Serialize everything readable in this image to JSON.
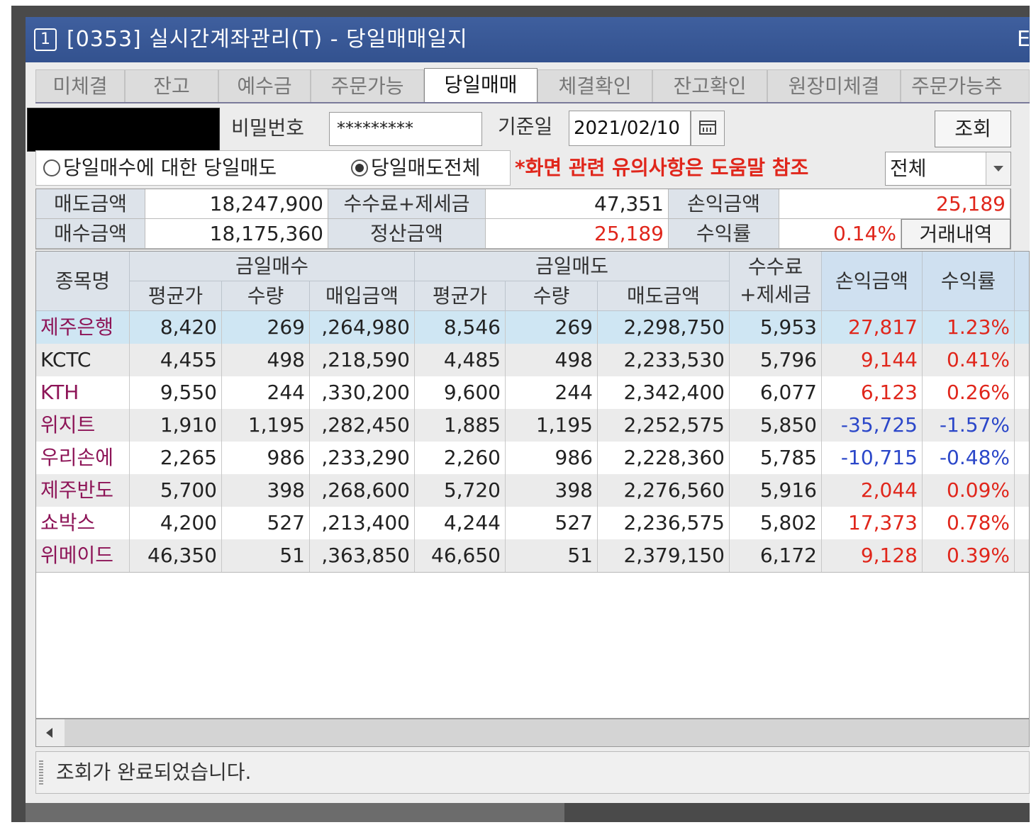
{
  "window": {
    "number": "1",
    "title": "[0353] 실시간계좌관리(T) - 당일매매일지",
    "title_right_glyph": "E"
  },
  "tabs": [
    {
      "label": "미체결",
      "active": false
    },
    {
      "label": "잔고",
      "active": false
    },
    {
      "label": "예수금",
      "active": false
    },
    {
      "label": "주문가능",
      "active": false
    },
    {
      "label": "당일매매",
      "active": true
    },
    {
      "label": "체결확인",
      "active": false
    },
    {
      "label": "잔고확인",
      "active": false
    },
    {
      "label": "원장미체결",
      "active": false
    },
    {
      "label": "주문가능추",
      "active": false
    }
  ],
  "query": {
    "password_label": "비밀번호",
    "password_value": "*********",
    "date_label": "기준일",
    "date_value": "2021/02/10",
    "search_button": "조회"
  },
  "options": {
    "radio1": "당일매수에 대한 당일매도",
    "radio2": "당일매도전체",
    "selected": "radio2",
    "notice": "*화면 관련 유의사항은 도움말 참조",
    "filter_value": "전체"
  },
  "summary": {
    "sell_amount_label": "매도금액",
    "sell_amount": "18,247,900",
    "fee_tax_label": "수수료+제세금",
    "fee_tax": "47,351",
    "pnl_label": "손익금액",
    "pnl": "25,189",
    "buy_amount_label": "매수금액",
    "buy_amount": "18,175,360",
    "settle_label": "정산금액",
    "settle": "25,189",
    "return_label": "수익률",
    "return_rate": "0.14%",
    "history_button": "거래내역"
  },
  "table": {
    "headers": {
      "name": "종목명",
      "buy_group": "금일매수",
      "sell_group": "금일매도",
      "fee_line1": "수수료",
      "fee_line2": "+제세금",
      "pnl": "손익금액",
      "rate": "수익률",
      "buy_avg": "평균가",
      "buy_qty": "수량",
      "buy_amount": "매입금액",
      "sell_avg": "평균가",
      "sell_qty": "수량",
      "sell_amount": "매도금액"
    },
    "rows": [
      {
        "name": "제주은행",
        "buy_avg": "8,420",
        "buy_qty": "269",
        "buy_amount": ",264,980",
        "sell_avg": "8,546",
        "sell_qty": "269",
        "sell_amount": "2,298,750",
        "fee": "5,953",
        "pnl": "27,817",
        "rate": "1.23%",
        "sign": "pos",
        "name_color": "#8d1457",
        "selected": true
      },
      {
        "name": "KCTC",
        "buy_avg": "4,455",
        "buy_qty": "498",
        "buy_amount": ",218,590",
        "sell_avg": "4,485",
        "sell_qty": "498",
        "sell_amount": "2,233,530",
        "fee": "5,796",
        "pnl": "9,144",
        "rate": "0.41%",
        "sign": "pos",
        "name_color": "#222222",
        "selected": false
      },
      {
        "name": "KTH",
        "buy_avg": "9,550",
        "buy_qty": "244",
        "buy_amount": ",330,200",
        "sell_avg": "9,600",
        "sell_qty": "244",
        "sell_amount": "2,342,400",
        "fee": "6,077",
        "pnl": "6,123",
        "rate": "0.26%",
        "sign": "pos",
        "name_color": "#8d1457",
        "selected": false
      },
      {
        "name": "위지트",
        "buy_avg": "1,910",
        "buy_qty": "1,195",
        "buy_amount": ",282,450",
        "sell_avg": "1,885",
        "sell_qty": "1,195",
        "sell_amount": "2,252,575",
        "fee": "5,850",
        "pnl": "-35,725",
        "rate": "-1.57%",
        "sign": "neg",
        "name_color": "#8d1457",
        "selected": false
      },
      {
        "name": "우리손에",
        "buy_avg": "2,265",
        "buy_qty": "986",
        "buy_amount": ",233,290",
        "sell_avg": "2,260",
        "sell_qty": "986",
        "sell_amount": "2,228,360",
        "fee": "5,785",
        "pnl": "-10,715",
        "rate": "-0.48%",
        "sign": "neg",
        "name_color": "#8d1457",
        "selected": false
      },
      {
        "name": "제주반도",
        "buy_avg": "5,700",
        "buy_qty": "398",
        "buy_amount": ",268,600",
        "sell_avg": "5,720",
        "sell_qty": "398",
        "sell_amount": "2,276,560",
        "fee": "5,916",
        "pnl": "2,044",
        "rate": "0.09%",
        "sign": "pos",
        "name_color": "#8d1457",
        "selected": false
      },
      {
        "name": "쇼박스",
        "buy_avg": "4,200",
        "buy_qty": "527",
        "buy_amount": ",213,400",
        "sell_avg": "4,244",
        "sell_qty": "527",
        "sell_amount": "2,236,575",
        "fee": "5,802",
        "pnl": "17,373",
        "rate": "0.78%",
        "sign": "pos",
        "name_color": "#8d1457",
        "selected": false
      },
      {
        "name": "위메이드",
        "buy_avg": "46,350",
        "buy_qty": "51",
        "buy_amount": ",363,850",
        "sell_avg": "46,650",
        "sell_qty": "51",
        "sell_amount": "2,379,150",
        "fee": "6,172",
        "pnl": "9,128",
        "rate": "0.39%",
        "sign": "pos",
        "name_color": "#8d1457",
        "selected": false
      }
    ]
  },
  "status": {
    "message": "조회가 완료되었습니다."
  },
  "colors": {
    "titlebar": "#3b5998",
    "positive": "#e0261b",
    "negative": "#2b47c9",
    "stock_name": "#8d1457",
    "selected_row": "#cfe6f3",
    "alt_row": "#ebebeb"
  }
}
